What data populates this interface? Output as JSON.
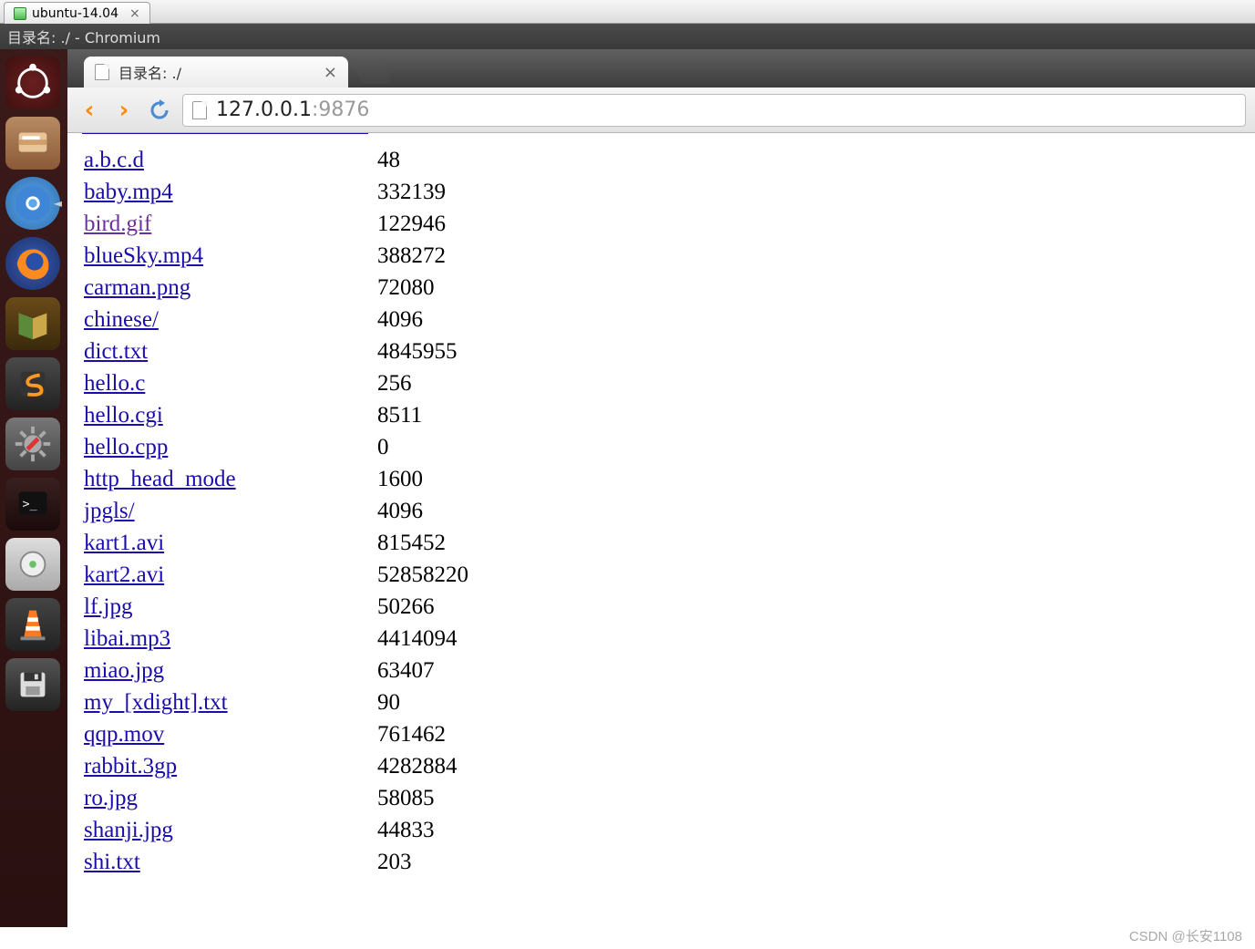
{
  "vm": {
    "tab_label": "ubuntu-14.04"
  },
  "window": {
    "title": "目录名: ./ - Chromium"
  },
  "launcher": {
    "items": [
      {
        "name": "ubuntu-dash-icon"
      },
      {
        "name": "files-icon"
      },
      {
        "name": "chromium-icon"
      },
      {
        "name": "firefox-icon"
      },
      {
        "name": "books-icon"
      },
      {
        "name": "sublime-icon"
      },
      {
        "name": "settings-icon"
      },
      {
        "name": "terminal-icon"
      },
      {
        "name": "media-icon"
      },
      {
        "name": "vlc-icon"
      },
      {
        "name": "save-icon"
      }
    ]
  },
  "browser": {
    "tab_title": "目录名: ./",
    "url_host": "127.0.0.1",
    "url_port": ":9876"
  },
  "files": [
    {
      "name": "a.b.c.d",
      "size": "48",
      "visited": false
    },
    {
      "name": "baby.mp4",
      "size": "332139",
      "visited": false
    },
    {
      "name": "bird.gif",
      "size": "122946",
      "visited": true
    },
    {
      "name": "blueSky.mp4",
      "size": "388272",
      "visited": false
    },
    {
      "name": "carman.png",
      "size": "72080",
      "visited": false
    },
    {
      "name": "chinese/",
      "size": "4096",
      "visited": false
    },
    {
      "name": "dict.txt",
      "size": "4845955",
      "visited": false
    },
    {
      "name": "hello.c",
      "size": "256",
      "visited": false
    },
    {
      "name": "hello.cgi",
      "size": "8511",
      "visited": false
    },
    {
      "name": "hello.cpp",
      "size": "0",
      "visited": false
    },
    {
      "name": "http_head_mode",
      "size": "1600",
      "visited": false
    },
    {
      "name": "jpgls/",
      "size": "4096",
      "visited": false
    },
    {
      "name": "kart1.avi",
      "size": "815452",
      "visited": false
    },
    {
      "name": "kart2.avi",
      "size": "52858220",
      "visited": false
    },
    {
      "name": "lf.jpg",
      "size": "50266",
      "visited": false
    },
    {
      "name": "libai.mp3",
      "size": "4414094",
      "visited": false
    },
    {
      "name": "miao.jpg",
      "size": "63407",
      "visited": false
    },
    {
      "name": "my_[xdight].txt",
      "size": "90",
      "visited": false
    },
    {
      "name": "qqp.mov",
      "size": "761462",
      "visited": false
    },
    {
      "name": "rabbit.3gp",
      "size": "4282884",
      "visited": false
    },
    {
      "name": "ro.jpg",
      "size": "58085",
      "visited": false
    },
    {
      "name": "shanji.jpg",
      "size": "44833",
      "visited": false
    },
    {
      "name": "shi.txt",
      "size": "203",
      "visited": false
    }
  ],
  "watermark": "CSDN @长安1108"
}
